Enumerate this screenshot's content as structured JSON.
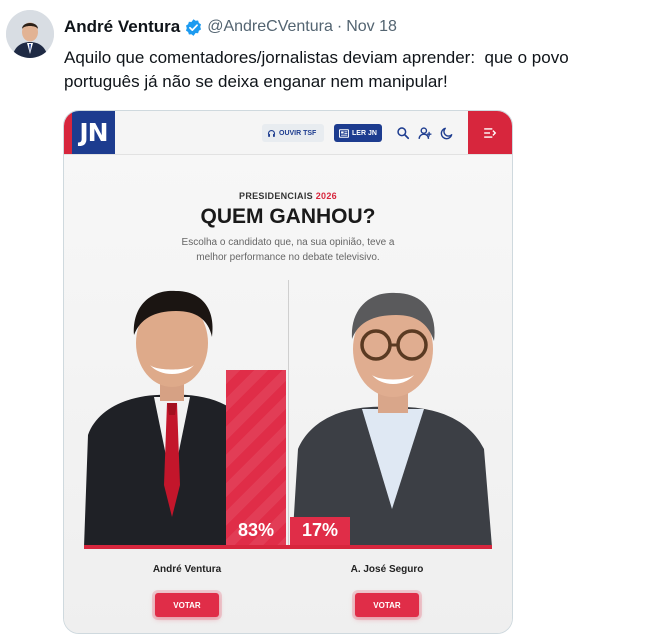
{
  "tweet": {
    "display_name": "André Ventura",
    "handle": "@AndreCVentura",
    "separator": "·",
    "date": "Nov 18",
    "text": "Aquilo que comentadores/jornalistas deviam aprender:  que o povo português já não se deixa enganar nem manipular!",
    "verified_icon": "verified-badge-icon",
    "colors": {
      "verified": "#1d9bf0",
      "text": "#0f1419",
      "muted": "#536471"
    }
  },
  "jn_site": {
    "logo": "JN",
    "ouvir_label": "OUVIR TSF",
    "ler_label": "LER JN",
    "icons": [
      "headphones-icon",
      "newspaper-icon",
      "search-icon",
      "user-icon",
      "moon-icon",
      "menu-icon"
    ],
    "colors": {
      "brand_blue": "#1d3c8f",
      "brand_red": "#d7263d"
    }
  },
  "poll": {
    "kicker": "PRESIDENCIAIS",
    "year": "2026",
    "title": "QUEM GANHOU?",
    "description": "Escolha o candidato que, na sua opinião, teve a melhor performance no debate televisivo.",
    "candidates": [
      {
        "name": "André Ventura",
        "percent_label": "83%",
        "percent": 83,
        "vote_label": "VOTAR"
      },
      {
        "name": "A. José Seguro",
        "percent_label": "17%",
        "percent": 17,
        "vote_label": "VOTAR"
      }
    ]
  }
}
